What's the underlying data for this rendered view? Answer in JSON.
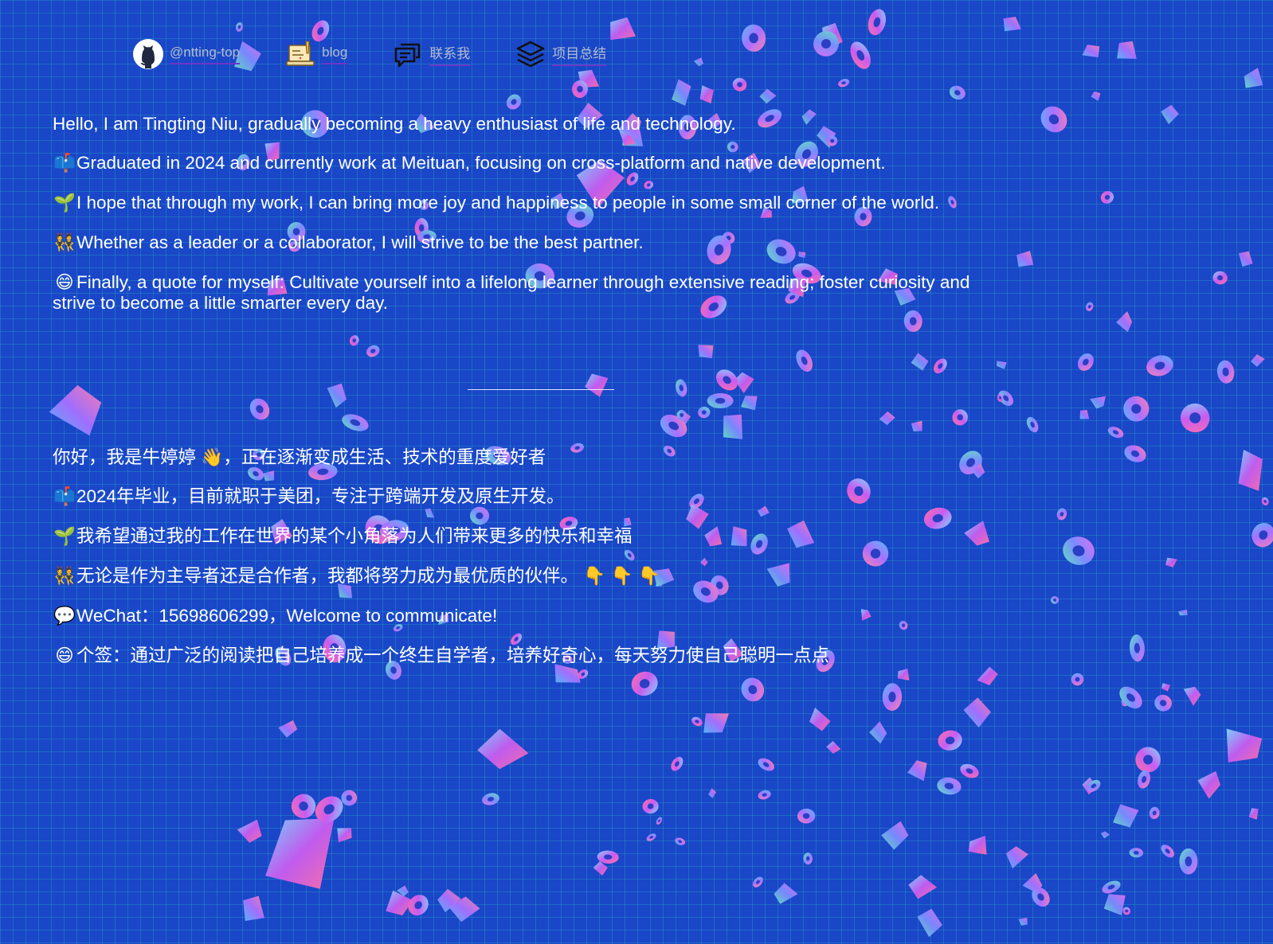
{
  "nav": [
    {
      "label": "@ntting-top",
      "icon": "github-icon"
    },
    {
      "label": "blog",
      "icon": "blog-laptop-icon"
    },
    {
      "label": "联系我",
      "icon": "chat-bubble-icon"
    },
    {
      "label": "项目总结",
      "icon": "layers-stack-icon"
    }
  ],
  "intro_en": [
    {
      "emoji": "",
      "text": "Hello, I am Tingting Niu, gradually becoming a heavy enthusiast of life and technology."
    },
    {
      "emoji": "📫",
      "text": "Graduated in 2024 and currently work at Meituan, focusing on cross-platform and native development."
    },
    {
      "emoji": "🌱",
      "text": "I hope that through my work, I can bring more joy and happiness to people in some small corner of the world."
    },
    {
      "emoji": "👯",
      "text": "Whether as a leader or a collaborator, I will strive to be the best partner."
    },
    {
      "emoji": "😄",
      "text": "Finally, a quote for myself: Cultivate yourself into a lifelong learner through extensive reading; foster curiosity and strive to become a little smarter every day."
    }
  ],
  "intro_cn": [
    {
      "emoji": "",
      "text": "你好，我是牛婷婷 👋，正在逐渐变成生活、技术的重度爱好者"
    },
    {
      "emoji": "📫",
      "text": "2024年毕业，目前就职于美团，专注于跨端开发及原生开发。"
    },
    {
      "emoji": "🌱",
      "text": "我希望通过我的工作在世界的某个小角落为人们带来更多的快乐和幸福"
    },
    {
      "emoji": "👯",
      "text": "无论是作为主导者还是合作者，我都将努力成为最优质的伙伴。 👇 👇 👇"
    },
    {
      "emoji": "💬",
      "text": "WeChat：15698606299，Welcome to communicate!"
    },
    {
      "emoji": "😄",
      "text": "个签：通过广泛的阅读把自己培养成一个终生自学者，培养好奇心，每天努力使自己聪明一点点"
    }
  ],
  "colors": {
    "background": "#1a46c8",
    "grid": "#28c8be",
    "nav_underline": "#6d35c9",
    "nav_text": "#b3bccf"
  }
}
